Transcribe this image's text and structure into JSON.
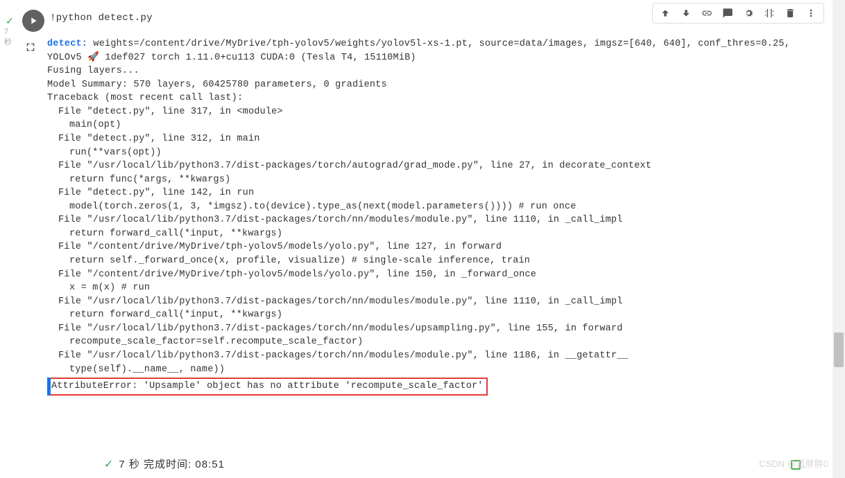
{
  "cell": {
    "code": "!python  detect.py"
  },
  "gutter": {
    "time": "7\n秒"
  },
  "output": {
    "detect_label": "detect:",
    "line1_rest": " weights=/content/drive/MyDrive/tph-yolov5/weights/yolov5l-xs-1.pt, source=data/images, imgsz=[640, 640], conf_thres=0.25,",
    "line2": "YOLOv5 🚀 1def027 torch 1.11.0+cu113 CUDA:0 (Tesla T4, 15110MiB)",
    "line3": "",
    "line4": "Fusing layers...",
    "line5": "Model Summary: 570 layers, 60425780 parameters, 0 gradients",
    "line6": "Traceback (most recent call last):",
    "line7": "File \"detect.py\", line 317, in <module>",
    "line8": "main(opt)",
    "line9": "File \"detect.py\", line 312, in main",
    "line10": "run(**vars(opt))",
    "line11": "File \"/usr/local/lib/python3.7/dist-packages/torch/autograd/grad_mode.py\", line 27, in decorate_context",
    "line12": "return func(*args, **kwargs)",
    "line13": "File \"detect.py\", line 142, in run",
    "line14": "model(torch.zeros(1, 3, *imgsz).to(device).type_as(next(model.parameters())))  # run once",
    "line15": "File \"/usr/local/lib/python3.7/dist-packages/torch/nn/modules/module.py\", line 1110, in _call_impl",
    "line16": "return forward_call(*input, **kwargs)",
    "line17": "File \"/content/drive/MyDrive/tph-yolov5/models/yolo.py\", line 127, in forward",
    "line18": "return self._forward_once(x, profile, visualize)  # single-scale inference, train",
    "line19": "File \"/content/drive/MyDrive/tph-yolov5/models/yolo.py\", line 150, in _forward_once",
    "line20": "x = m(x)  # run",
    "line21": "File \"/usr/local/lib/python3.7/dist-packages/torch/nn/modules/module.py\", line 1110, in _call_impl",
    "line22": "return forward_call(*input, **kwargs)",
    "line23": "File \"/usr/local/lib/python3.7/dist-packages/torch/nn/modules/upsampling.py\", line 155, in forward",
    "line24": "recompute_scale_factor=self.recompute_scale_factor)",
    "line25": "File \"/usr/local/lib/python3.7/dist-packages/torch/nn/modules/module.py\", line 1186, in __getattr__",
    "line26": "type(self).__name__, name))",
    "error": "AttributeError: 'Upsample' object has no attribute 'recompute_scale_factor'"
  },
  "status": {
    "text": "7 秒  完成时间: 08:51"
  },
  "watermark": "CSDN @蓝胖胖0"
}
